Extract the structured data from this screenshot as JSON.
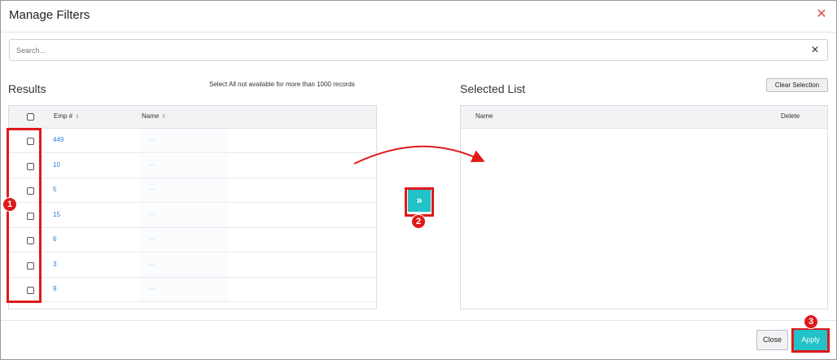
{
  "dialog": {
    "title": "Manage Filters"
  },
  "search": {
    "placeholder": "Search...",
    "value": ""
  },
  "results": {
    "title": "Results",
    "note": "Select All not available for more than 1000 records",
    "columns": {
      "emp": "Emp #",
      "name": "Name"
    },
    "rows": [
      {
        "emp": "449",
        "name": "—"
      },
      {
        "emp": "10",
        "name": "—"
      },
      {
        "emp": "5",
        "name": "—"
      },
      {
        "emp": "15",
        "name": "—"
      },
      {
        "emp": "6",
        "name": "—"
      },
      {
        "emp": "3",
        "name": "—"
      },
      {
        "emp": "9",
        "name": "—"
      }
    ]
  },
  "selected": {
    "title": "Selected List",
    "clear_label": "Clear Selection",
    "columns": {
      "name": "Name",
      "delete": "Delete"
    }
  },
  "move_button": {
    "glyph": "»"
  },
  "footer": {
    "close_label": "Close",
    "apply_label": "Apply"
  },
  "annotations": {
    "step1": "1",
    "step2": "2",
    "step3": "3"
  },
  "colors": {
    "accent": "#21c2c8",
    "annotation": "#e01919",
    "link": "#2a7fd4"
  }
}
